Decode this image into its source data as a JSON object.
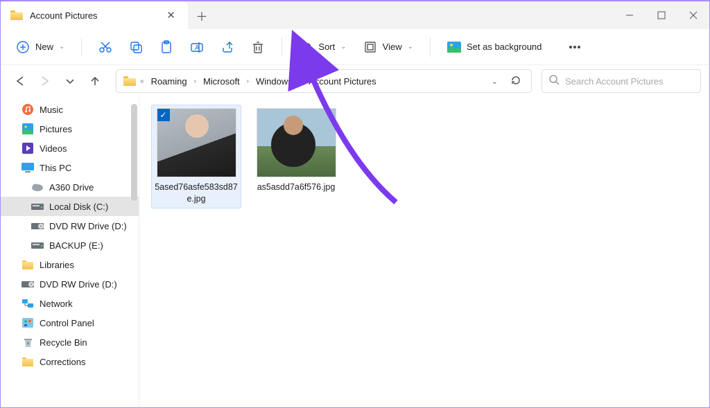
{
  "window": {
    "tab_title": "Account Pictures"
  },
  "toolbar": {
    "new_label": "New",
    "sort_label": "Sort",
    "view_label": "View",
    "background_label": "Set as background"
  },
  "breadcrumbs": {
    "items": [
      "Roaming",
      "Microsoft",
      "Windows",
      "Account Pictures"
    ]
  },
  "search": {
    "placeholder": "Search Account Pictures"
  },
  "sidebar": {
    "items": [
      {
        "label": "Music",
        "icon": "music",
        "indent": false
      },
      {
        "label": "Pictures",
        "icon": "pictures",
        "indent": false
      },
      {
        "label": "Videos",
        "icon": "videos",
        "indent": false
      },
      {
        "label": "This PC",
        "icon": "thispc",
        "indent": false
      },
      {
        "label": "A360 Drive",
        "icon": "cloud",
        "indent": true
      },
      {
        "label": "Local Disk (C:)",
        "icon": "disk",
        "indent": true,
        "active": true
      },
      {
        "label": "DVD RW Drive (D:)",
        "icon": "dvd",
        "indent": true
      },
      {
        "label": "BACKUP (E:)",
        "icon": "disk",
        "indent": true
      },
      {
        "label": "Libraries",
        "icon": "folder",
        "indent": false
      },
      {
        "label": "DVD RW Drive (D:)",
        "icon": "dvd",
        "indent": false
      },
      {
        "label": "Network",
        "icon": "network",
        "indent": false
      },
      {
        "label": "Control Panel",
        "icon": "control",
        "indent": false
      },
      {
        "label": "Recycle Bin",
        "icon": "recycle",
        "indent": false
      },
      {
        "label": "Corrections",
        "icon": "folder",
        "indent": false
      }
    ]
  },
  "files": [
    {
      "name": "5ased76asfe583sd87e.jpg",
      "selected": true,
      "thumb": "img1"
    },
    {
      "name": "as5asdd7a6f576.jpg",
      "selected": false,
      "thumb": "img2"
    }
  ],
  "colors": {
    "accent": "#0067c0",
    "annotation": "#7c3aed"
  }
}
